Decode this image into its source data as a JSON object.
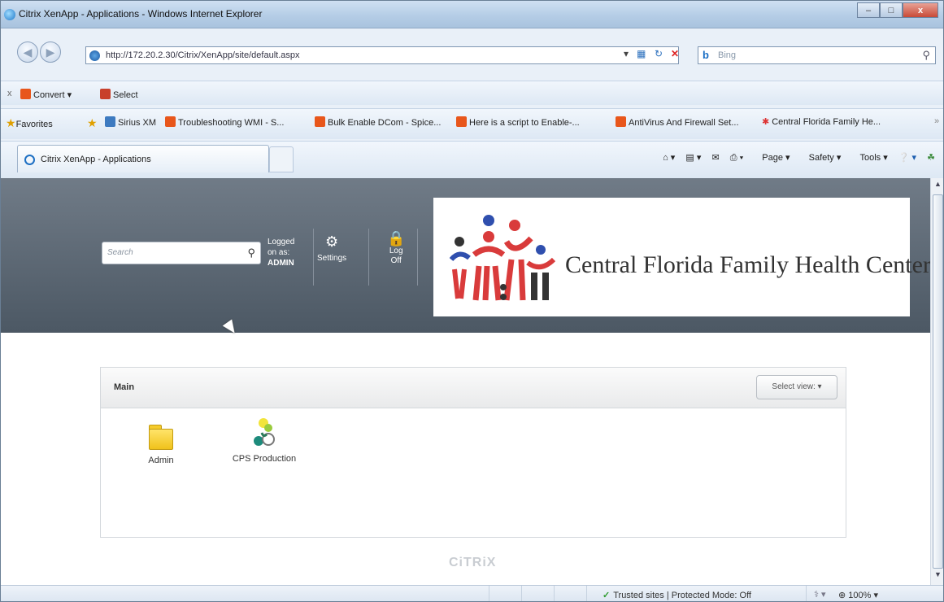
{
  "window": {
    "title": "Citrix XenApp - Applications - Windows Internet Explorer",
    "buttons": {
      "minimize": "–",
      "maximize": "□",
      "close": "x"
    }
  },
  "address": {
    "url": "http://172.20.2.30/Citrix/XenApp/site/default.aspx",
    "search_placeholder": "Bing"
  },
  "toolbar": {
    "close": "x",
    "convert": "Convert",
    "select": "Select"
  },
  "favorites": {
    "label": "Favorites",
    "items": [
      "Sirius XM",
      "Troubleshooting WMI - S...",
      "Bulk Enable DCom - Spice...",
      "Here is a script to Enable-...",
      "AntiVirus And Firewall Set...",
      "Central Florida Family He..."
    ]
  },
  "tabs": {
    "active": "Citrix XenApp - Applications"
  },
  "commands": {
    "page": "Page",
    "safety": "Safety",
    "tools": "Tools"
  },
  "site": {
    "search_placeholder": "Search",
    "logged_line1": "Logged",
    "logged_line2": "on as:",
    "username": "ADMIN",
    "settings": "Settings",
    "logoff_line1": "Log",
    "logoff_line2": "Off",
    "logo_text": "Central Florida Family Health Center"
  },
  "apps": {
    "section_label": "Main",
    "view_button": "Select view:",
    "items": [
      {
        "label": "Admin"
      },
      {
        "label": "CPS Production"
      }
    ]
  },
  "footer": {
    "brand": "CiTRiX"
  },
  "status": {
    "zone": "Trusted sites | Protected Mode: Off",
    "zoom": "100%"
  },
  "colors": {
    "header_gradient_top": "#707b87",
    "header_gradient_bottom": "#4c5864",
    "logo_red": "#d93b3b",
    "logo_blue": "#2f4fae",
    "logo_dark": "#333333"
  }
}
